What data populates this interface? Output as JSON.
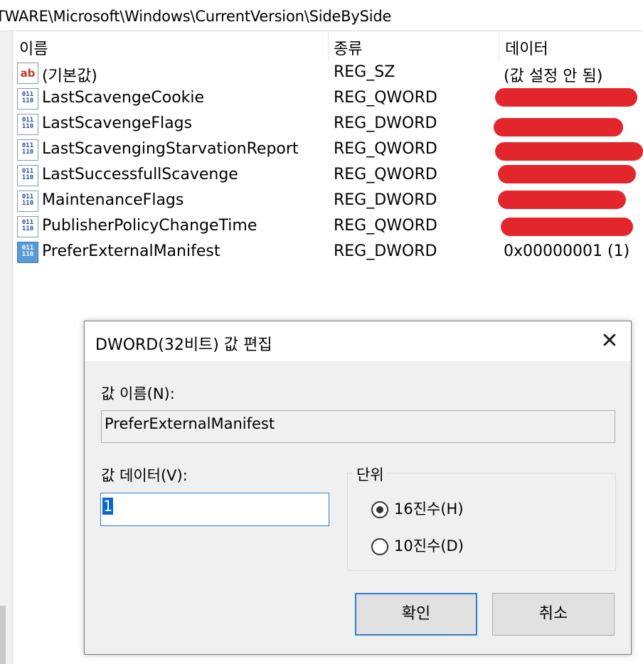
{
  "address": "TWARE\\Microsoft\\Windows\\CurrentVersion\\SideBySide",
  "columns": {
    "name": "이름",
    "type": "종류",
    "data": "데이터"
  },
  "rows": [
    {
      "icon": "string-value-icon",
      "name": "(기본값)",
      "type": "REG_SZ",
      "data": "(값 설정 안 됨)"
    },
    {
      "icon": "binary-value-icon",
      "name": "LastScavengeCookie",
      "type": "REG_QWORD",
      "data": ""
    },
    {
      "icon": "binary-value-icon",
      "name": "LastScavengeFlags",
      "type": "REG_DWORD",
      "data": ""
    },
    {
      "icon": "binary-value-icon",
      "name": "LastScavengingStarvationReport",
      "type": "REG_QWORD",
      "data": ""
    },
    {
      "icon": "binary-value-icon",
      "name": "LastSuccessfullScavenge",
      "type": "REG_QWORD",
      "data": ""
    },
    {
      "icon": "binary-value-icon",
      "name": "MaintenanceFlags",
      "type": "REG_DWORD",
      "data": ""
    },
    {
      "icon": "binary-value-icon",
      "name": "PublisherPolicyChangeTime",
      "type": "REG_QWORD",
      "data": ""
    },
    {
      "icon": "binary-value-icon",
      "name": "PreferExternalManifest",
      "type": "REG_DWORD",
      "data": "0x00000001 (1)"
    }
  ],
  "dialog": {
    "title": "DWORD(32비트) 값 편집",
    "close": "✕",
    "value_name_label": "값 이름(N):",
    "value_name": "PreferExternalManifest",
    "value_data_label": "값 데이터(V):",
    "value_data": "1",
    "base_label": "단위",
    "radio_hex": "16진수(H)",
    "radio_dec": "10진수(D)",
    "selected_base": "hex",
    "ok": "확인",
    "cancel": "취소"
  },
  "colors": {
    "accent": "#2a7fd0",
    "redaction": "#e3262b"
  }
}
